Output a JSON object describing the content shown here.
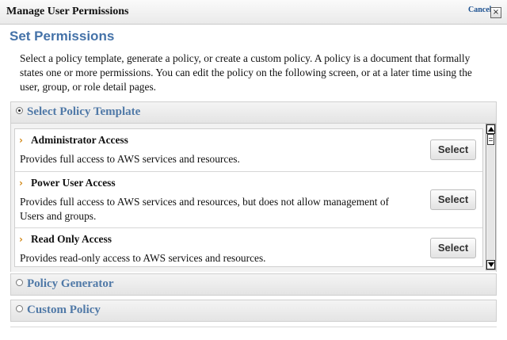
{
  "dialog": {
    "title": "Manage User Permissions",
    "cancel_label": "Cancel",
    "close_glyph": "×"
  },
  "page": {
    "heading": "Set Permissions",
    "intro": "Select a policy template, generate a policy, or create a custom policy. A policy is a document that formally states one or more permissions. You can edit the policy on the following screen, or at a later time using the user, group, or role detail pages."
  },
  "sections": [
    {
      "label": "Select Policy Template",
      "selected": true
    },
    {
      "label": "Policy Generator",
      "selected": false
    },
    {
      "label": "Custom Policy",
      "selected": false
    }
  ],
  "templates": [
    {
      "name": "Administrator Access",
      "description": "Provides full access to AWS services and resources.",
      "button_label": "Select"
    },
    {
      "name": "Power User Access",
      "description": "Provides full access to AWS services and resources, but does not allow management of Users and groups.",
      "button_label": "Select"
    },
    {
      "name": "Read Only Access",
      "description": "Provides read-only access to AWS services and resources.",
      "button_label": "Select"
    }
  ],
  "glyphs": {
    "item_arrow": "›"
  },
  "colors": {
    "heading": "#4472a8",
    "section_title": "#5079a7",
    "item_arrow": "#d28a1a",
    "cancel_link": "#1a4f8f"
  }
}
